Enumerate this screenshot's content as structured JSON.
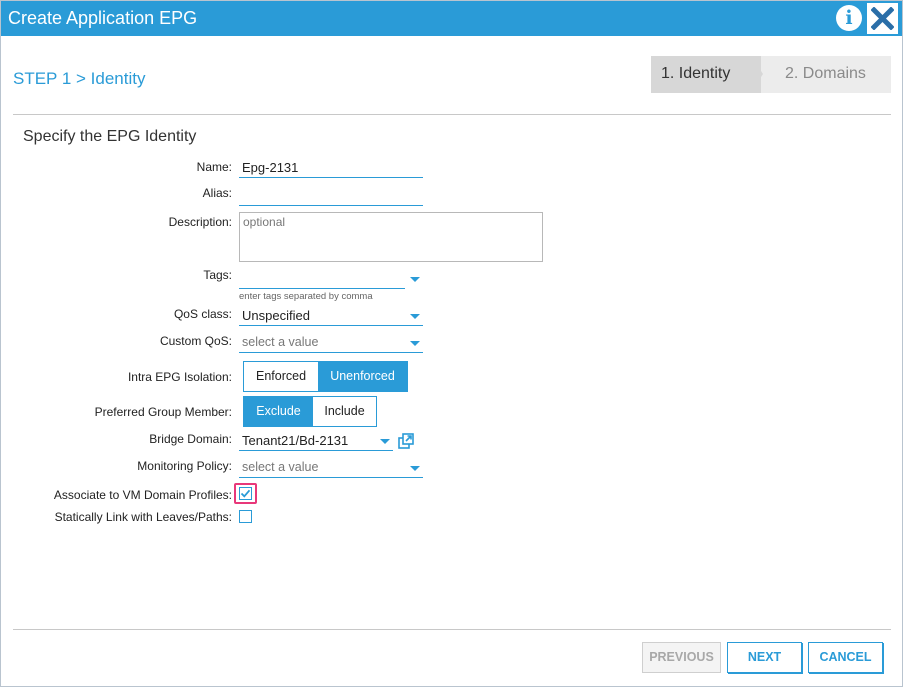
{
  "dialog": {
    "title": "Create Application EPG",
    "info_icon": "info-icon",
    "close_icon": "close-icon"
  },
  "step": {
    "heading": "STEP 1 > Identity"
  },
  "wizard": {
    "steps": [
      {
        "label": "1. Identity",
        "active": true
      },
      {
        "label": "2. Domains",
        "active": false
      }
    ]
  },
  "form": {
    "section_title": "Specify the EPG Identity",
    "name": {
      "label": "Name:",
      "value": "Epg-2131"
    },
    "alias": {
      "label": "Alias:",
      "value": ""
    },
    "description": {
      "label": "Description:",
      "placeholder": "optional",
      "value": ""
    },
    "tags": {
      "label": "Tags:",
      "value": "",
      "hint": "enter tags separated by comma"
    },
    "qos_class": {
      "label": "QoS class:",
      "value": "Unspecified"
    },
    "custom_qos": {
      "label": "Custom QoS:",
      "placeholder": "select a value"
    },
    "intra_epg_isolation": {
      "label": "Intra EPG Isolation:",
      "options": [
        "Enforced",
        "Unenforced"
      ],
      "selected": "Unenforced"
    },
    "preferred_group_member": {
      "label": "Preferred Group Member:",
      "options": [
        "Exclude",
        "Include"
      ],
      "selected": "Exclude"
    },
    "bridge_domain": {
      "label": "Bridge Domain:",
      "value": "Tenant21/Bd-2131"
    },
    "monitoring_policy": {
      "label": "Monitoring Policy:",
      "placeholder": "select a value"
    },
    "associate_vm_domain": {
      "label": "Associate to VM Domain Profiles:",
      "checked": true
    },
    "static_link": {
      "label": "Statically Link with Leaves/Paths:",
      "checked": false
    }
  },
  "footer": {
    "previous_label": "PREVIOUS",
    "next_label": "NEXT",
    "cancel_label": "CANCEL"
  },
  "colors": {
    "accent": "#2a9bd7",
    "highlight": "#e8387a"
  }
}
